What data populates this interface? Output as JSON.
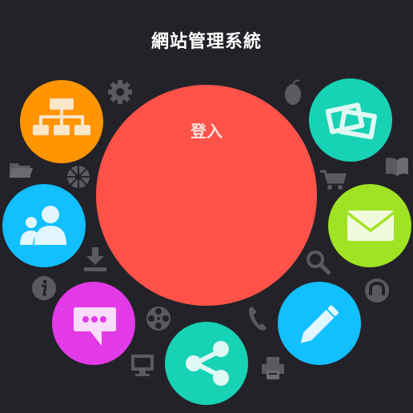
{
  "header": {
    "title": "網站管理系統"
  },
  "login": {
    "label": "登入"
  },
  "colors": {
    "background": "#232229",
    "login": "#ff5248",
    "sitemap": "#ff9500",
    "gallery": "#17d2b4",
    "users": "#12bfff",
    "mail": "#a0e322",
    "chat": "#e23ae6",
    "share": "#17d2b4",
    "edit": "#12bfff",
    "small_icons": "#5b5a61"
  },
  "apps": [
    {
      "icon": "sitemap-icon"
    },
    {
      "icon": "gallery-icon"
    },
    {
      "icon": "users-icon"
    },
    {
      "icon": "mail-icon"
    },
    {
      "icon": "chat-icon"
    },
    {
      "icon": "share-icon"
    },
    {
      "icon": "pencil-icon"
    }
  ],
  "decorative_icons": [
    "gear-icon",
    "mouse-icon",
    "folder-icon",
    "lens-icon",
    "cart-icon",
    "book-icon",
    "download-icon",
    "search-icon",
    "info-icon",
    "film-reel-icon",
    "phone-icon",
    "monitor-icon",
    "printer-icon",
    "magnet-icon"
  ]
}
